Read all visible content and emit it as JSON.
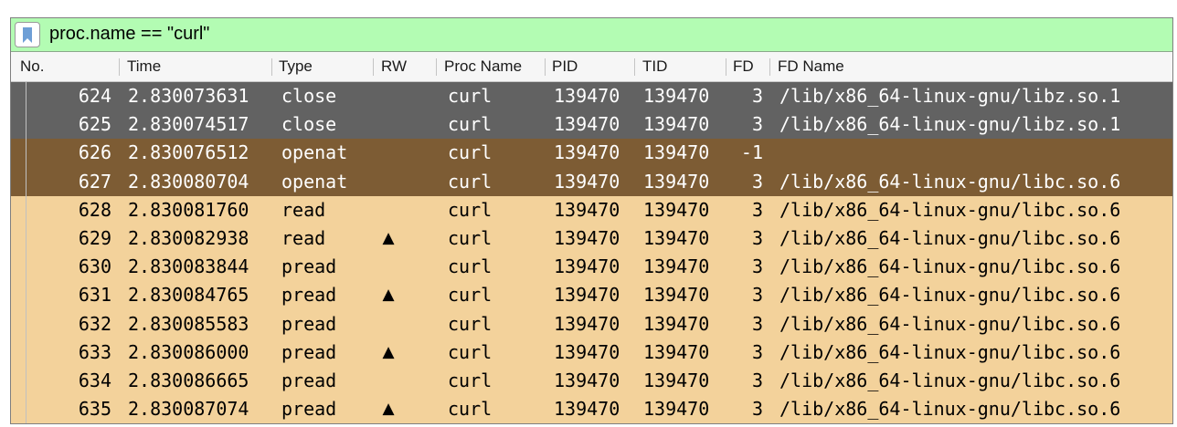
{
  "filter": {
    "icon": "bookmark-icon",
    "expression": "proc.name == \"curl\"",
    "background": "#b3fcb3"
  },
  "columns": [
    "No.",
    "Time",
    "Type",
    "RW",
    "Proc Name",
    "PID",
    "TID",
    "FD",
    "FD Name"
  ],
  "row_colors": {
    "gray": "#626262",
    "brown": "#7d5c34",
    "tan": "#f3d29b"
  },
  "rows": [
    {
      "no": "624",
      "time": "2.830073631",
      "type": "close",
      "rw": "",
      "proc": "curl",
      "pid": "139470",
      "tid": "139470",
      "fd": "3",
      "fdname": "/lib/x86_64-linux-gnu/libz.so.1",
      "style": "gray"
    },
    {
      "no": "625",
      "time": "2.830074517",
      "type": "close",
      "rw": "",
      "proc": "curl",
      "pid": "139470",
      "tid": "139470",
      "fd": "3",
      "fdname": "/lib/x86_64-linux-gnu/libz.so.1",
      "style": "gray"
    },
    {
      "no": "626",
      "time": "2.830076512",
      "type": "openat",
      "rw": "",
      "proc": "curl",
      "pid": "139470",
      "tid": "139470",
      "fd": "-1",
      "fdname": "",
      "style": "brown"
    },
    {
      "no": "627",
      "time": "2.830080704",
      "type": "openat",
      "rw": "",
      "proc": "curl",
      "pid": "139470",
      "tid": "139470",
      "fd": "3",
      "fdname": "/lib/x86_64-linux-gnu/libc.so.6",
      "style": "brown"
    },
    {
      "no": "628",
      "time": "2.830081760",
      "type": "read",
      "rw": "",
      "proc": "curl",
      "pid": "139470",
      "tid": "139470",
      "fd": "3",
      "fdname": "/lib/x86_64-linux-gnu/libc.so.6",
      "style": "tan"
    },
    {
      "no": "629",
      "time": "2.830082938",
      "type": "read",
      "rw": "▲",
      "proc": "curl",
      "pid": "139470",
      "tid": "139470",
      "fd": "3",
      "fdname": "/lib/x86_64-linux-gnu/libc.so.6",
      "style": "tan"
    },
    {
      "no": "630",
      "time": "2.830083844",
      "type": "pread",
      "rw": "",
      "proc": "curl",
      "pid": "139470",
      "tid": "139470",
      "fd": "3",
      "fdname": "/lib/x86_64-linux-gnu/libc.so.6",
      "style": "tan"
    },
    {
      "no": "631",
      "time": "2.830084765",
      "type": "pread",
      "rw": "▲",
      "proc": "curl",
      "pid": "139470",
      "tid": "139470",
      "fd": "3",
      "fdname": "/lib/x86_64-linux-gnu/libc.so.6",
      "style": "tan"
    },
    {
      "no": "632",
      "time": "2.830085583",
      "type": "pread",
      "rw": "",
      "proc": "curl",
      "pid": "139470",
      "tid": "139470",
      "fd": "3",
      "fdname": "/lib/x86_64-linux-gnu/libc.so.6",
      "style": "tan"
    },
    {
      "no": "633",
      "time": "2.830086000",
      "type": "pread",
      "rw": "▲",
      "proc": "curl",
      "pid": "139470",
      "tid": "139470",
      "fd": "3",
      "fdname": "/lib/x86_64-linux-gnu/libc.so.6",
      "style": "tan"
    },
    {
      "no": "634",
      "time": "2.830086665",
      "type": "pread",
      "rw": "",
      "proc": "curl",
      "pid": "139470",
      "tid": "139470",
      "fd": "3",
      "fdname": "/lib/x86_64-linux-gnu/libc.so.6",
      "style": "tan"
    },
    {
      "no": "635",
      "time": "2.830087074",
      "type": "pread",
      "rw": "▲",
      "proc": "curl",
      "pid": "139470",
      "tid": "139470",
      "fd": "3",
      "fdname": "/lib/x86_64-linux-gnu/libc.so.6",
      "style": "tan"
    }
  ]
}
